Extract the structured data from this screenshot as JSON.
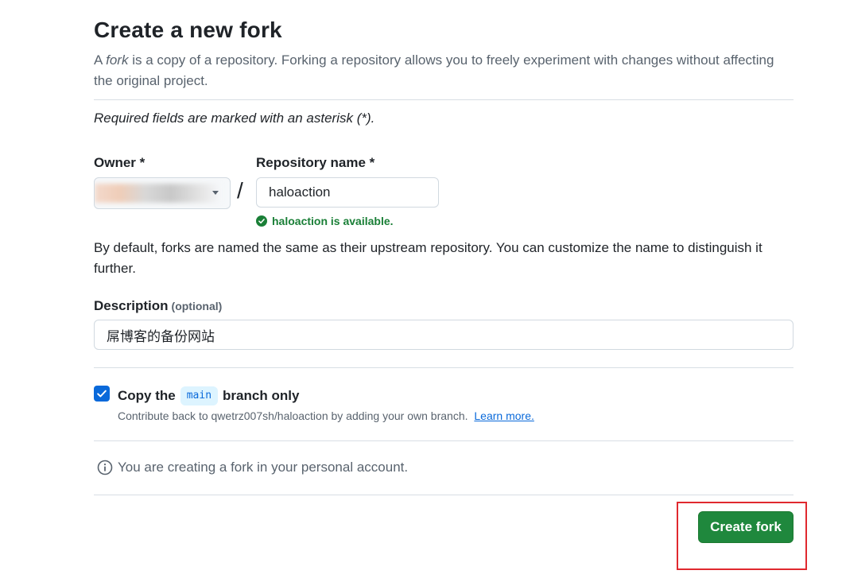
{
  "header": {
    "title": "Create a new fork",
    "subtitle_prefix": "A ",
    "subtitle_em": "fork",
    "subtitle_rest": " is a copy of a repository. Forking a repository allows you to freely experiment with changes without affecting the original project."
  },
  "form": {
    "required_note": "Required fields are marked with an asterisk (*).",
    "owner": {
      "label": "Owner *"
    },
    "separator": "/",
    "repository_name": {
      "label": "Repository name *",
      "value": "haloaction",
      "availability": "haloaction is available."
    },
    "naming_help": "By default, forks are named the same as their upstream repository. You can customize the name to distinguish it further.",
    "description": {
      "label": "Description",
      "optional": "(optional)",
      "value": "屌博客的备份网站"
    },
    "copy_branch": {
      "checked": true,
      "label_before": "Copy the",
      "branch": "main",
      "label_after": "branch only",
      "note": "Contribute back to qwetrz007sh/haloaction by adding your own branch.",
      "learn_more": "Learn more."
    },
    "info": "You are creating a fork in your personal account.",
    "submit_label": "Create fork"
  },
  "colors": {
    "accent": "#0969da",
    "success": "#1a7f37",
    "primary_button": "#1f883d",
    "highlight": "#e0292f"
  }
}
